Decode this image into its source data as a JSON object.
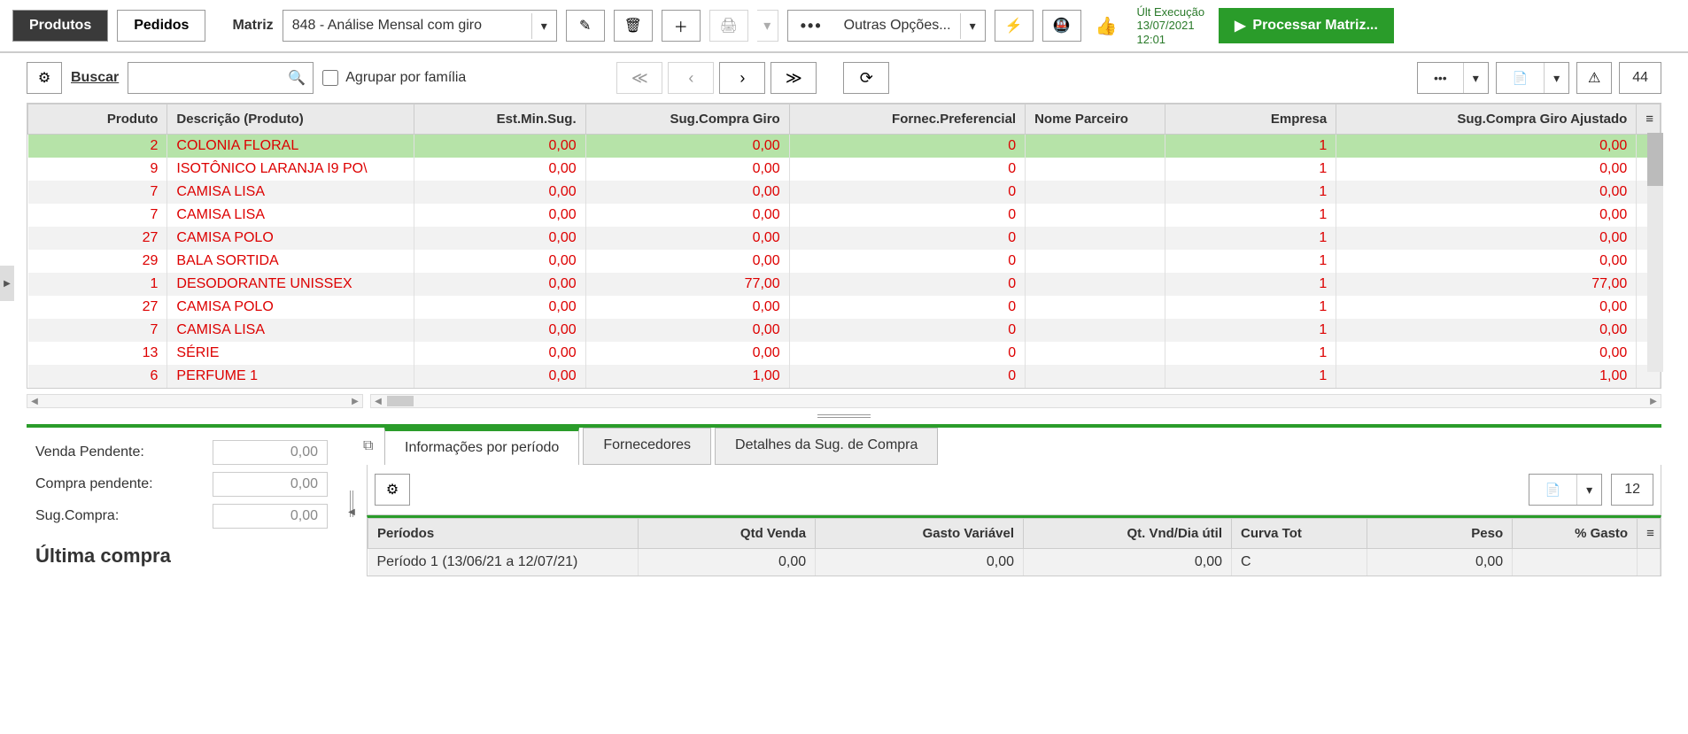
{
  "header": {
    "tab_produtos": "Produtos",
    "tab_pedidos": "Pedidos",
    "matrix_label": "Matriz",
    "matrix_value": "848 - Análise Mensal com giro",
    "other_options": "Outras Opções...",
    "last_exec_label": "Últ Execução",
    "last_exec_date": "13/07/2021",
    "last_exec_time": "12:01",
    "process_btn": "Processar Matriz..."
  },
  "search": {
    "buscar": "Buscar",
    "group_family": "Agrupar por família",
    "count": "44"
  },
  "table": {
    "headers": {
      "produto": "Produto",
      "descricao": "Descrição (Produto)",
      "est_min": "Est.Min.Sug.",
      "sug_compra_giro": "Sug.Compra Giro",
      "fornec": "Fornec.Preferencial",
      "nome_parceiro": "Nome Parceiro",
      "empresa": "Empresa",
      "sug_ajustado": "Sug.Compra Giro Ajustado"
    },
    "rows": [
      {
        "produto": "2",
        "descricao": "COLONIA FLORAL",
        "est_min": "0,00",
        "sug": "0,00",
        "fornec": "0",
        "nome": "",
        "empresa": "1",
        "ajustado": "0,00",
        "selected": true
      },
      {
        "produto": "9",
        "descricao": "ISOTÔNICO LARANJA I9 PO\\",
        "est_min": "0,00",
        "sug": "0,00",
        "fornec": "0",
        "nome": "",
        "empresa": "1",
        "ajustado": "0,00"
      },
      {
        "produto": "7",
        "descricao": "CAMISA LISA",
        "est_min": "0,00",
        "sug": "0,00",
        "fornec": "0",
        "nome": "",
        "empresa": "1",
        "ajustado": "0,00"
      },
      {
        "produto": "7",
        "descricao": "CAMISA LISA",
        "est_min": "0,00",
        "sug": "0,00",
        "fornec": "0",
        "nome": "",
        "empresa": "1",
        "ajustado": "0,00"
      },
      {
        "produto": "27",
        "descricao": "CAMISA POLO",
        "est_min": "0,00",
        "sug": "0,00",
        "fornec": "0",
        "nome": "",
        "empresa": "1",
        "ajustado": "0,00"
      },
      {
        "produto": "29",
        "descricao": "BALA SORTIDA",
        "est_min": "0,00",
        "sug": "0,00",
        "fornec": "0",
        "nome": "",
        "empresa": "1",
        "ajustado": "0,00"
      },
      {
        "produto": "1",
        "descricao": "DESODORANTE UNISSEX",
        "est_min": "0,00",
        "sug": "77,00",
        "fornec": "0",
        "nome": "",
        "empresa": "1",
        "ajustado": "77,00"
      },
      {
        "produto": "27",
        "descricao": "CAMISA POLO",
        "est_min": "0,00",
        "sug": "0,00",
        "fornec": "0",
        "nome": "",
        "empresa": "1",
        "ajustado": "0,00"
      },
      {
        "produto": "7",
        "descricao": "CAMISA LISA",
        "est_min": "0,00",
        "sug": "0,00",
        "fornec": "0",
        "nome": "",
        "empresa": "1",
        "ajustado": "0,00"
      },
      {
        "produto": "13",
        "descricao": "SÉRIE",
        "est_min": "0,00",
        "sug": "0,00",
        "fornec": "0",
        "nome": "",
        "empresa": "1",
        "ajustado": "0,00"
      },
      {
        "produto": "6",
        "descricao": "PERFUME 1",
        "est_min": "0,00",
        "sug": "1,00",
        "fornec": "0",
        "nome": "",
        "empresa": "1",
        "ajustado": "1,00"
      }
    ]
  },
  "detail": {
    "venda_pendente_lbl": "Venda Pendente:",
    "venda_pendente": "0,00",
    "compra_pendente_lbl": "Compra pendente:",
    "compra_pendente": "0,00",
    "sug_compra_lbl": "Sug.Compra:",
    "sug_compra": "0,00",
    "ultima_compra_title": "Última compra"
  },
  "tabs": {
    "info_periodo": "Informações por período",
    "fornecedores": "Fornecedores",
    "detalhes_sug": "Detalhes da Sug. de Compra",
    "count": "12"
  },
  "period_table": {
    "headers": {
      "periodos": "Períodos",
      "qtd_venda": "Qtd Venda",
      "gasto_var": "Gasto Variável",
      "qt_vnd_dia": "Qt. Vnd/Dia útil",
      "curva_tot": "Curva Tot",
      "peso": "Peso",
      "pct_gasto": "% Gasto"
    },
    "rows": [
      {
        "periodo": "Período 1 (13/06/21 a 12/07/21)",
        "qtd": "0,00",
        "gasto": "0,00",
        "qt_dia": "0,00",
        "curva": "C",
        "peso": "0,00",
        "pct": ""
      }
    ]
  }
}
